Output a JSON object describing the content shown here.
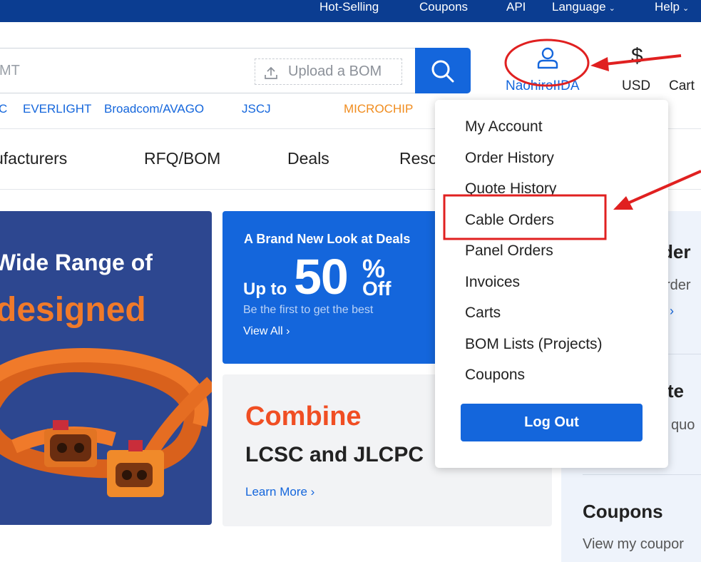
{
  "top_nav": {
    "hot_selling": "Hot-Selling",
    "coupons": "Coupons",
    "api": "API",
    "language": "Language",
    "help": "Help"
  },
  "search": {
    "placeholder": "MT",
    "upload_bom": "Upload a BOM"
  },
  "account": {
    "username": "NaohiroIIDA",
    "currency_symbol": "$",
    "currency": "USD",
    "cart": "Cart"
  },
  "brands": [
    "C",
    "EVERLIGHT",
    "Broadcom/AVAGO",
    "JSCJ",
    "MICROCHIP"
  ],
  "main_nav": [
    "ufacturers",
    "RFQ/BOM",
    "Deals",
    "Reso"
  ],
  "hero": {
    "line1": "Wide Range of",
    "line2": "designed"
  },
  "deals_banner": {
    "title": "A Brand New Look at Deals",
    "up_to": "Up to",
    "amount": "50",
    "percent": "%",
    "off": "Off",
    "subtitle": "Be the first to get the best",
    "view_all": "View All ›"
  },
  "combine_banner": {
    "title": "Combine",
    "subtitle": "LCSC and JLCPC",
    "learn_more": "Learn More ›"
  },
  "right_panel": {
    "order_title": "der",
    "order_sub": "rder",
    "order_arrow": "›",
    "quote_title": "ote",
    "quote_sub": "quo",
    "coupons_title": "Coupons",
    "coupons_sub": "View my coupor"
  },
  "account_menu": {
    "items": [
      "My Account",
      "Order History",
      "Quote History",
      "Cable Orders",
      "Panel Orders",
      "Invoices",
      "Carts",
      "BOM Lists (Projects)",
      "Coupons"
    ],
    "logout": "Log Out"
  },
  "colors": {
    "brand_blue": "#1466dc",
    "top_bar": "#0b3d91",
    "annotation_red": "#e02020",
    "microchip_orange": "#f08c1e",
    "combine_red": "#f04e23",
    "hero_orange": "#f07a2a"
  },
  "icons": {
    "search_button": "search-icon",
    "upload": "upload-icon",
    "user": "user-icon",
    "chevron": "chevron-down-icon"
  }
}
